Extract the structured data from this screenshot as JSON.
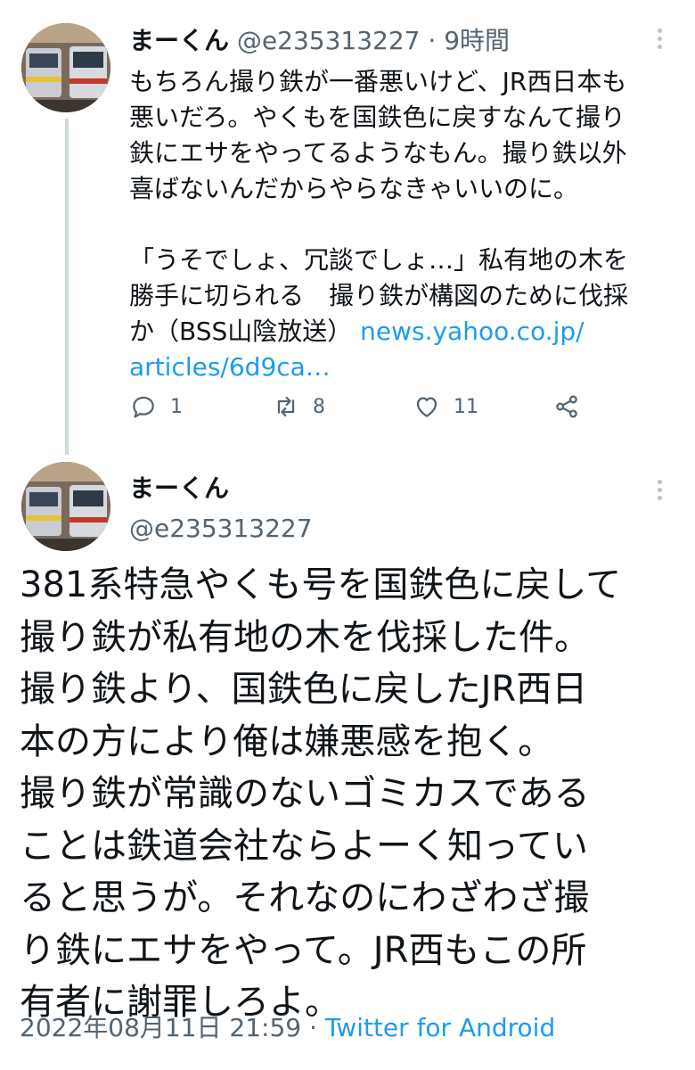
{
  "tweet1": {
    "display_name": "まーくん",
    "handle": "@e235313227",
    "separator": "·",
    "time": "9時間",
    "text_lines": [
      "もちろん撮り鉄が一番悪いけど、JR西日本も",
      "悪いだろ。やくもを国鉄色に戻すなんて撮り",
      "鉄にエサをやってるようなもん。撮り鉄以外",
      "喜ばないんだからやらなきゃいいのに。"
    ],
    "quote_lines": [
      "「うそでしょ、冗談でしょ…」私有地の木を",
      "勝手に切られる　撮り鉄が構図のために伐採"
    ],
    "quote_last_prefix": "か（BSS山陰放送）",
    "link_part1": "news.yahoo.co.jp/",
    "link_part2": "articles/6d9ca…",
    "reply_count": "1",
    "retweet_count": "8",
    "like_count": "11"
  },
  "tweet2": {
    "display_name": "まーくん",
    "handle": "@e235313227",
    "text_lines": [
      "381系特急やくも号を国鉄色に戻して",
      "撮り鉄が私有地の木を伐採した件。",
      "撮り鉄より、国鉄色に戻したJR西日",
      "本の方により俺は嫌悪感を抱く。",
      "撮り鉄が常識のないゴミカスである",
      "ことは鉄道会社ならよーく知ってい",
      "ると思うが。それなのにわざわざ撮",
      "り鉄にエサをやって。JR西もこの所",
      "有者に謝罪しろよ。"
    ],
    "date": "2022年08月11日 21:59",
    "separator": "·",
    "client": "Twitter for Android"
  },
  "colors": {
    "text": "#0f1419",
    "secondary": "#536471",
    "link": "#1d9bf0",
    "thread_line": "#cfd9de"
  },
  "icons": [
    "reply-icon",
    "retweet-icon",
    "like-icon",
    "share-icon",
    "more-icon"
  ]
}
